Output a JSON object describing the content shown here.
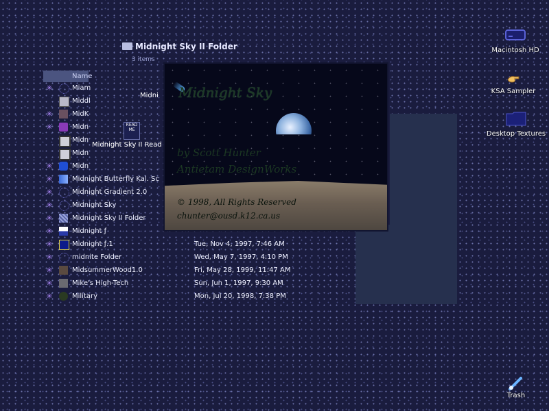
{
  "desktop": {
    "macintosh_hd": "Macintosh HD",
    "ksa_sampler": "KSA Sampler",
    "desktop_textures": "Desktop Textures",
    "trash": "Trash"
  },
  "window": {
    "title": "Midnight Sky II Folder",
    "count": "3 items",
    "name_header": "Name"
  },
  "floating": {
    "midni": "Midni",
    "readme_badge": "READ ME",
    "readme_label": "Midnight Sky II Read"
  },
  "files": [
    {
      "name": "Miam",
      "date": ""
    },
    {
      "name": "Middl",
      "date": ""
    },
    {
      "name": "MidK",
      "date": ""
    },
    {
      "name": "Midn",
      "date": ""
    },
    {
      "name": "Midn",
      "date": ""
    },
    {
      "name": "Midn",
      "date": ""
    },
    {
      "name": "Midn",
      "date": ""
    },
    {
      "name": "Midnight Butterfly Kal. Sc",
      "date": ""
    },
    {
      "name": "Midnight Gradient 2.0",
      "date": ""
    },
    {
      "name": "Midnight Sky",
      "date": ""
    },
    {
      "name": "Midnight Sky II Folder",
      "date": ""
    },
    {
      "name": "Midnight ƒ",
      "date": ""
    },
    {
      "name": "Midnight ƒ.1",
      "date": "Tue, Nov 4, 1997, 7:46 AM"
    },
    {
      "name": "midnite Folder",
      "date": "Wed, May 7, 1997, 4:10 PM"
    },
    {
      "name": "MidsummerWood1.0",
      "date": "Fri, May 28, 1999, 11:47 AM"
    },
    {
      "name": "Mike's High-Tech",
      "date": "Sun, Jun 1, 1997, 9:30 AM"
    },
    {
      "name": "Military",
      "date": "Mon, Jul 20, 1998, 7:38 PM"
    }
  ],
  "splash": {
    "title": "Midnight Sky",
    "byline1": "by Scott Hunter",
    "byline2": "Antietam DesignWorks",
    "copyright": "© 1998, All Rights Reserved",
    "email": "chunter@ousd.k12.ca.us"
  }
}
